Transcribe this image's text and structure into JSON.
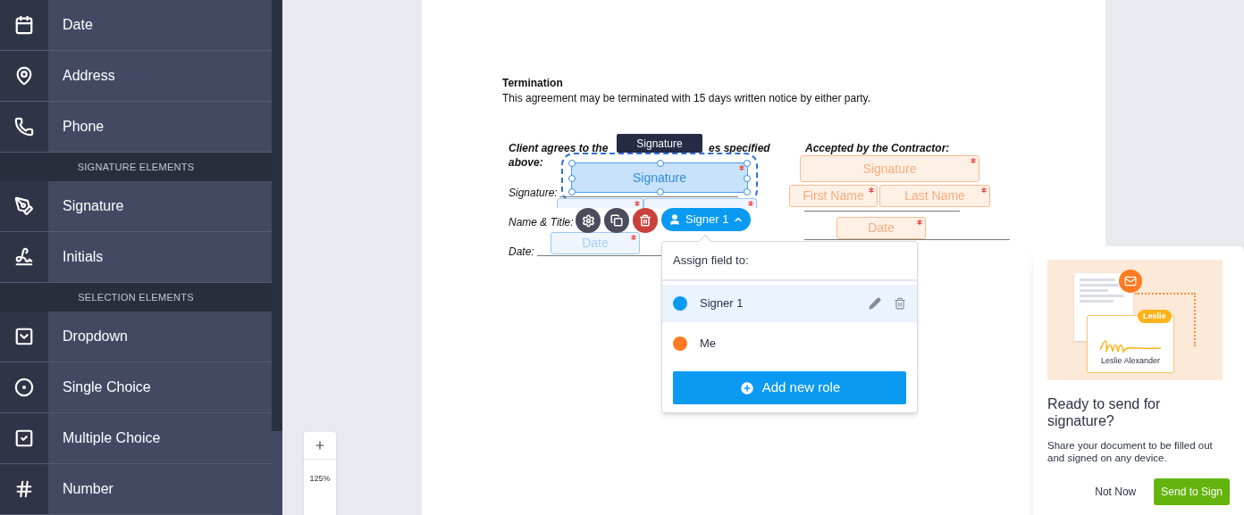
{
  "sidebar": {
    "sections": [
      {
        "items": [
          {
            "label": "Date"
          },
          {
            "label": "Address"
          },
          {
            "label": "Phone"
          }
        ]
      },
      {
        "header": "SIGNATURE ELEMENTS",
        "items": [
          {
            "label": "Signature"
          },
          {
            "label": "Initials"
          }
        ]
      },
      {
        "header": "SELECTION ELEMENTS",
        "items": [
          {
            "label": "Dropdown"
          },
          {
            "label": "Single Choice"
          },
          {
            "label": "Multiple Choice"
          },
          {
            "label": "Number"
          }
        ]
      }
    ]
  },
  "zoom": {
    "value": "125%"
  },
  "document": {
    "heading": "Termination",
    "paragraph": "This agreement may be terminated with 15 days written notice by either party.",
    "client_title_parts": [
      "Client agrees to the",
      "es specified",
      "above:"
    ],
    "client_labels": [
      "Signature:",
      "Name & Title:",
      "Date:"
    ],
    "contractor_title": "Accepted by the Contractor:",
    "fields": [
      {
        "label": "Signature",
        "color": "#4a9ff0",
        "required": true,
        "selected": true
      },
      {
        "color": "#9cc8f2",
        "required": true,
        "selected": false
      },
      {
        "color": "#9cc8f2",
        "required": true,
        "selected": false
      },
      {
        "label": "Date",
        "color": "#9cc8f2",
        "required": true,
        "selected": false
      },
      {
        "label": "Signature",
        "color": "#f9bb8f",
        "required": true,
        "selected": false
      },
      {
        "label": "First Name",
        "color": "#f9bb8f",
        "required": true,
        "selected": false
      },
      {
        "label": "Last Name",
        "color": "#f9bb8f",
        "required": true,
        "selected": false
      },
      {
        "label": "Date",
        "color": "#f9bb8f",
        "required": true,
        "selected": false
      }
    ],
    "tooltip": "Signature",
    "role_button": {
      "label": "Signer 1",
      "expanded": true
    }
  },
  "popover": {
    "title": "Assign field to:",
    "roles": [
      {
        "label": "Signer 1",
        "color": "#0a9af2",
        "selected": true
      },
      {
        "label": "Me",
        "color": "#ff7a21",
        "selected": false
      }
    ],
    "add_button": "Add new role"
  },
  "send_card": {
    "badge": "Leslie",
    "signer_name": "Leslie Alexander",
    "title": "Ready to send for signature?",
    "description": "Share your document to be filled out and signed on any device.",
    "buttons": [
      "Not Now",
      "Send to Sign"
    ]
  }
}
